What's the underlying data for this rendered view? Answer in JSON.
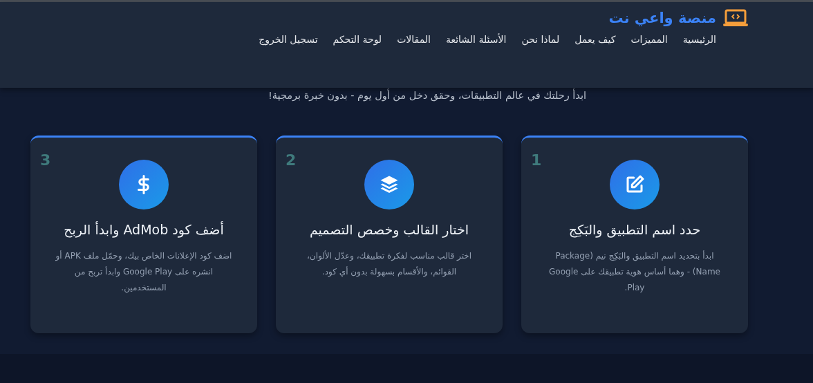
{
  "brand": {
    "name": "منصة واعي نت"
  },
  "nav": [
    "الرئيسية",
    "المميزات",
    "كيف يعمل",
    "لماذا نحن",
    "الأسئلة الشائعة",
    "المقالات",
    "لوحة التحكم",
    "تسجيل الخروج"
  ],
  "subtitle": "ابدأ رحلتك في عالم التطبيقات، وحقق دخل من أول يوم - بدون خبرة برمجية!",
  "steps": [
    {
      "number": "1",
      "kind": "edit",
      "title": "حدد اسم التطبيق والبَكِج",
      "description": "ابدأ بتحديد اسم التطبيق والبَكِج نيم (Package Name) - وهما أساس هوية تطبيقك على Google Play."
    },
    {
      "number": "2",
      "kind": "layers",
      "title": "اختار القالب وخصص التصميم",
      "description": "اختر قالب مناسب لفكرة تطبيقك، وعدّل الألوان، القوائم، والأقسام بسهولة بدون أي كود."
    },
    {
      "number": "3",
      "kind": "dollar",
      "title": "أضف كود AdMob وابدأ الربح",
      "description": "اضف كود الإعلانات الخاص بيك، وحمّل ملف APK أو انشره على Google Play وابدأ تربح من المستخدمين."
    }
  ]
}
